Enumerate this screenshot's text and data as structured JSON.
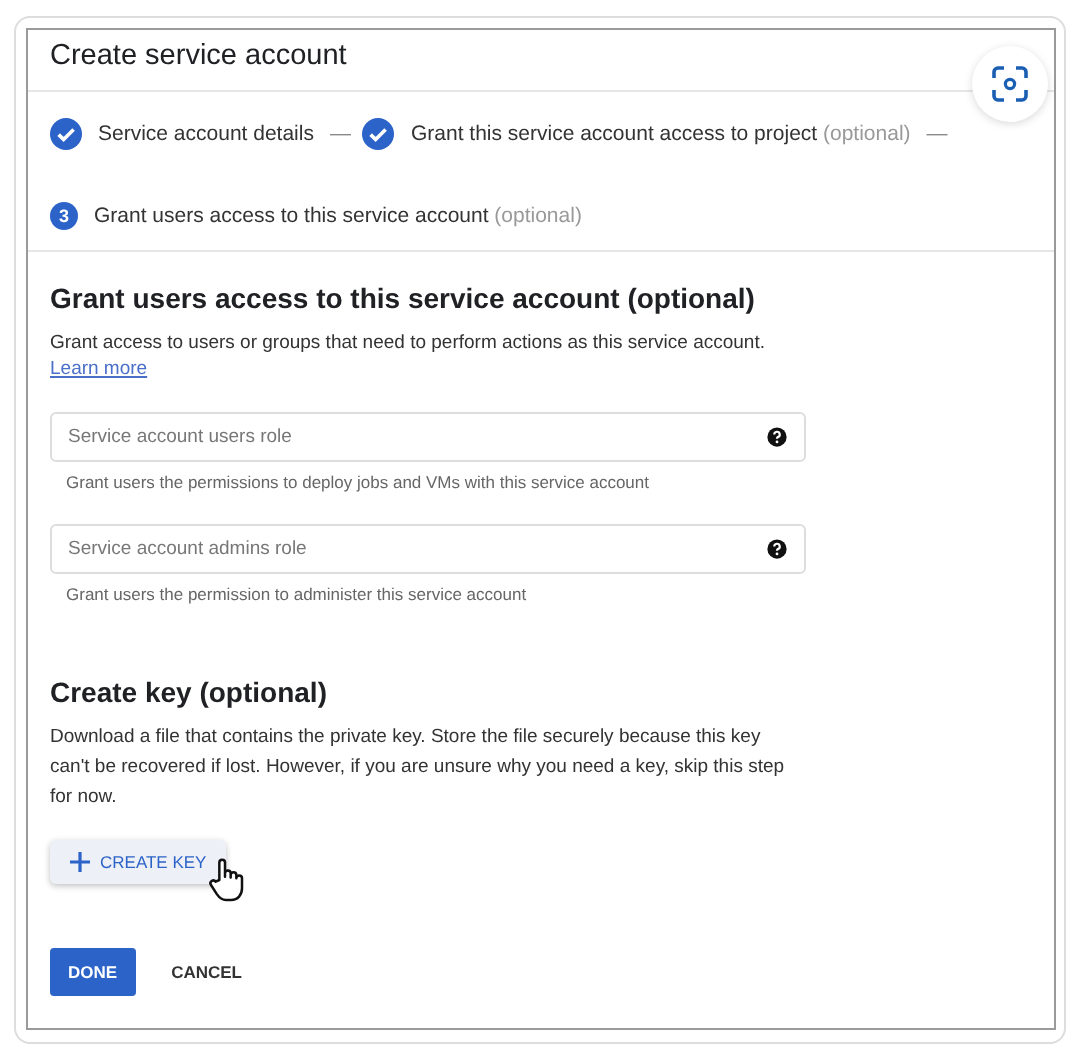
{
  "dialog": {
    "title": "Create service account"
  },
  "steps": [
    {
      "kind": "done",
      "label": "Service account details"
    },
    {
      "kind": "done",
      "label": "Grant this service account access to project",
      "note": "(optional)"
    },
    {
      "kind": "current",
      "marker": "3",
      "label": "Grant users access to this service account",
      "note": "(optional)"
    }
  ],
  "step_separator": "—",
  "access_section": {
    "heading": "Grant users access to this service account (optional)",
    "description": "Grant access to users or groups that need to perform actions as this service account.",
    "link": "Learn more",
    "fields": [
      {
        "placeholder": "Service account users role",
        "hint": "Grant users the permissions to deploy jobs and VMs with this service account"
      },
      {
        "placeholder": "Service account admins role",
        "hint": "Grant users the permission to administer this service account"
      }
    ]
  },
  "key_section": {
    "heading": "Create key (optional)",
    "description": "Download a file that contains the private key. Store the file securely because this key can't be recovered if lost. However, if you are unsure why you need a key, skip this step for now.",
    "button": "CREATE KEY"
  },
  "buttons": [
    {
      "kind": "primary",
      "label": "DONE"
    },
    {
      "kind": "text",
      "label": "CANCEL"
    }
  ]
}
